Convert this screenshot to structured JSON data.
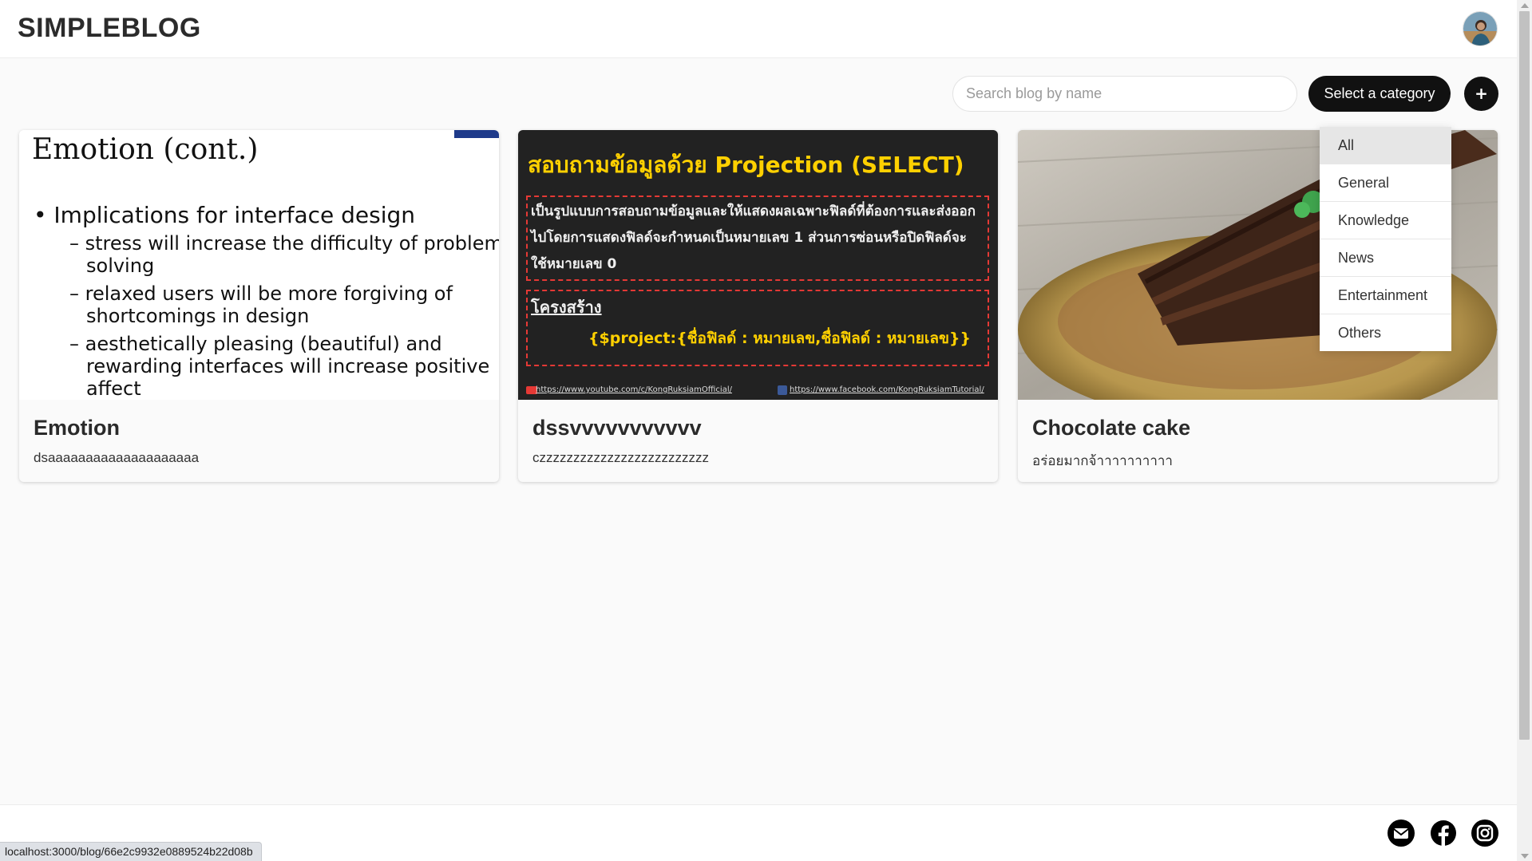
{
  "header": {
    "brand": "SIMPLEBLOG",
    "avatar_icon": "user-avatar-icon"
  },
  "toolbar": {
    "search_placeholder": "Search blog by name",
    "search_value": "",
    "category_label": "Select a category",
    "add_label": "+"
  },
  "category_dropdown": {
    "options": [
      "All",
      "General",
      "Knowledge",
      "News",
      "Entertainment",
      "Others"
    ],
    "selected": "All"
  },
  "blogs": [
    {
      "title": "Emotion",
      "description": "dsaaaaaaaaaaaaaaaaaaaa",
      "thumbnail": {
        "heading": "Emotion (cont.)",
        "bullet": "Implications for interface design",
        "subpoints": [
          "stress will increase the difficulty of problem",
          "solving",
          "relaxed users will be more forgiving of",
          "shortcomings in design",
          "aesthetically pleasing (beautiful) and",
          "rewarding interfaces will increase positive",
          "affect"
        ]
      }
    },
    {
      "title": "dssvvvvvvvvvvv",
      "description": "czzzzzzzzzzzzzzzzzzzzzzzzz",
      "thumbnail": {
        "heading": "สอบถามข้อมูลด้วย Projection (SELECT)",
        "body": "เป็นรูปแบบการสอบถามข้อมูลและให้แสดงผลเฉพาะฟิลด์ที่ต้องการและส่งออกไปโดยการแสดงฟิลด์จะกำหนดเป็นหมายเลข 1 ส่วนการซ่อนหรือปิดฟิลด์จะใช้หมายเลข 0",
        "structure_label": "โครงสร้าง",
        "code": "{$project:{ชื่อฟิลด์ : หมายเลข,ชื่อฟิลด์ : หมายเลข}}",
        "youtube_link": "https://www.youtube.com/c/KongRuksiamOfficial/",
        "facebook_link": "https://www.facebook.com/KongRuksiamTutorial/"
      }
    },
    {
      "title": "Chocolate cake",
      "description": "อร่อยมากจ้าาาาาาาาาา",
      "thumbnail": {
        "image": "chocolate-cake-photo"
      }
    }
  ],
  "footer": {
    "icons": [
      "email-icon",
      "facebook-icon",
      "instagram-icon"
    ]
  },
  "status_bar": {
    "url": "localhost:3000/blog/66e2c9932e0889524b22d08b"
  }
}
